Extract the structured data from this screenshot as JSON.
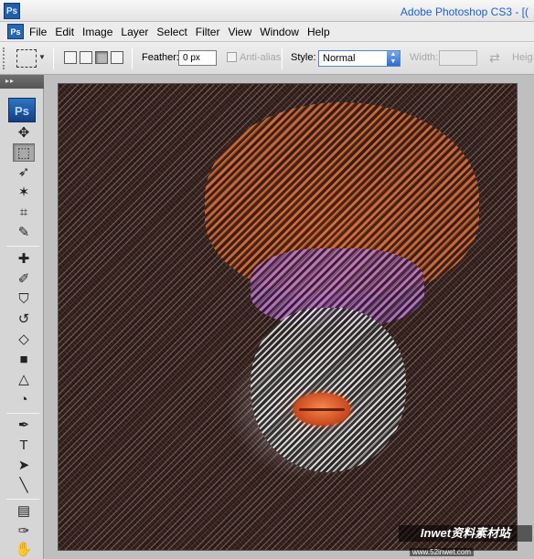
{
  "titlebar": {
    "app_logo": "Ps",
    "title": "Adobe Photoshop CS3 - [("
  },
  "menubar": {
    "doc_icon": "Ps",
    "items": [
      "File",
      "Edit",
      "Image",
      "Layer",
      "Select",
      "Filter",
      "View",
      "Window",
      "Help"
    ]
  },
  "options": {
    "feather_label": "Feather:",
    "feather_value": "0 px",
    "antialias_label": "Anti-alias",
    "style_label": "Style:",
    "style_value": "Normal",
    "width_label": "Width:",
    "height_label": "Heig"
  },
  "toolbox": {
    "header": "▸▸",
    "logo": "Ps",
    "tools": [
      {
        "name": "move-tool",
        "icon": "✥"
      },
      {
        "name": "marquee-tool",
        "icon": "⬚",
        "active": true
      },
      {
        "name": "lasso-tool",
        "icon": "➶"
      },
      {
        "name": "magic-wand-tool",
        "icon": "✶"
      },
      {
        "name": "crop-tool",
        "icon": "⌗"
      },
      {
        "name": "slice-tool",
        "icon": "✎"
      },
      {
        "name": "healing-brush-tool",
        "icon": "✚"
      },
      {
        "name": "brush-tool",
        "icon": "✐"
      },
      {
        "name": "clone-stamp-tool",
        "icon": "⛉"
      },
      {
        "name": "history-brush-tool",
        "icon": "↺"
      },
      {
        "name": "eraser-tool",
        "icon": "◇"
      },
      {
        "name": "gradient-tool",
        "icon": "■"
      },
      {
        "name": "blur-tool",
        "icon": "△"
      },
      {
        "name": "dodge-tool",
        "icon": "◔"
      },
      {
        "name": "pen-tool",
        "icon": "✒"
      },
      {
        "name": "type-tool",
        "icon": "T"
      },
      {
        "name": "path-selection-tool",
        "icon": "➤"
      },
      {
        "name": "line-tool",
        "icon": "╲"
      },
      {
        "name": "notes-tool",
        "icon": "▤"
      },
      {
        "name": "eyedropper-tool",
        "icon": "✑"
      },
      {
        "name": "hand-tool",
        "icon": "✋"
      }
    ]
  },
  "canvas": {
    "watermark": "Inwet资料素材站",
    "watermark_url": "www.52inwet.com"
  },
  "colors": {
    "title_text": "#1e5fcf",
    "hair": "#e0723a",
    "glasses": "#c47bd2",
    "lips": "#e8602a",
    "background": "#3a2420"
  }
}
